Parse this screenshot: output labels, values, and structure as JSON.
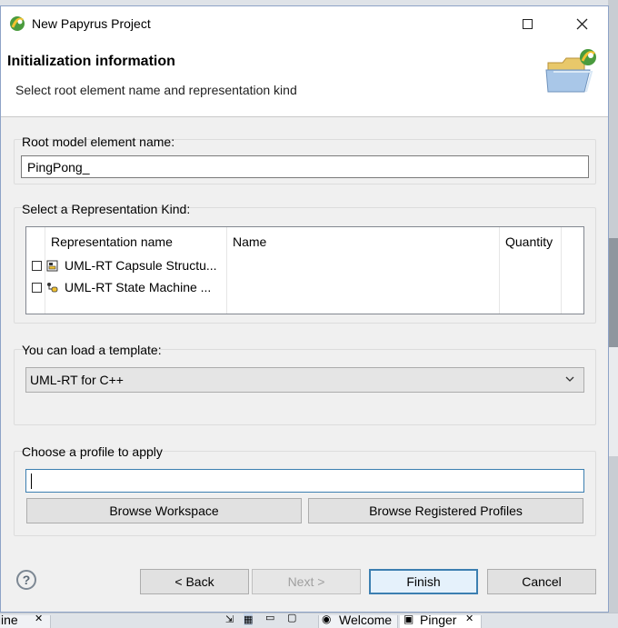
{
  "window": {
    "title": "New Papyrus Project"
  },
  "header": {
    "title": "Initialization information",
    "subtitle": "Select root element name and representation kind"
  },
  "root_model": {
    "label": "Root model element name:",
    "value": "PingPong_"
  },
  "representation": {
    "label": "Select a Representation Kind:",
    "columns": [
      "Representation name",
      "Name",
      "Quantity"
    ],
    "rows": [
      {
        "label": "UML-RT Capsule Structu...",
        "icon": "capsule-structure-icon",
        "checked": false
      },
      {
        "label": "UML-RT State Machine ...",
        "icon": "state-machine-icon",
        "checked": false
      }
    ]
  },
  "template": {
    "label": "You can load a template:",
    "selected": "UML-RT for C++"
  },
  "profile": {
    "label": "Choose a profile to apply",
    "value": "",
    "browse_workspace": "Browse Workspace",
    "browse_registered": "Browse Registered Profiles"
  },
  "footer": {
    "back": "< Back",
    "next": "Next >",
    "finish": "Finish",
    "cancel": "Cancel"
  },
  "taskbar": {
    "left_tab": "tline",
    "welcome_tab": "Welcome",
    "pinger_tab": "Pinger"
  }
}
